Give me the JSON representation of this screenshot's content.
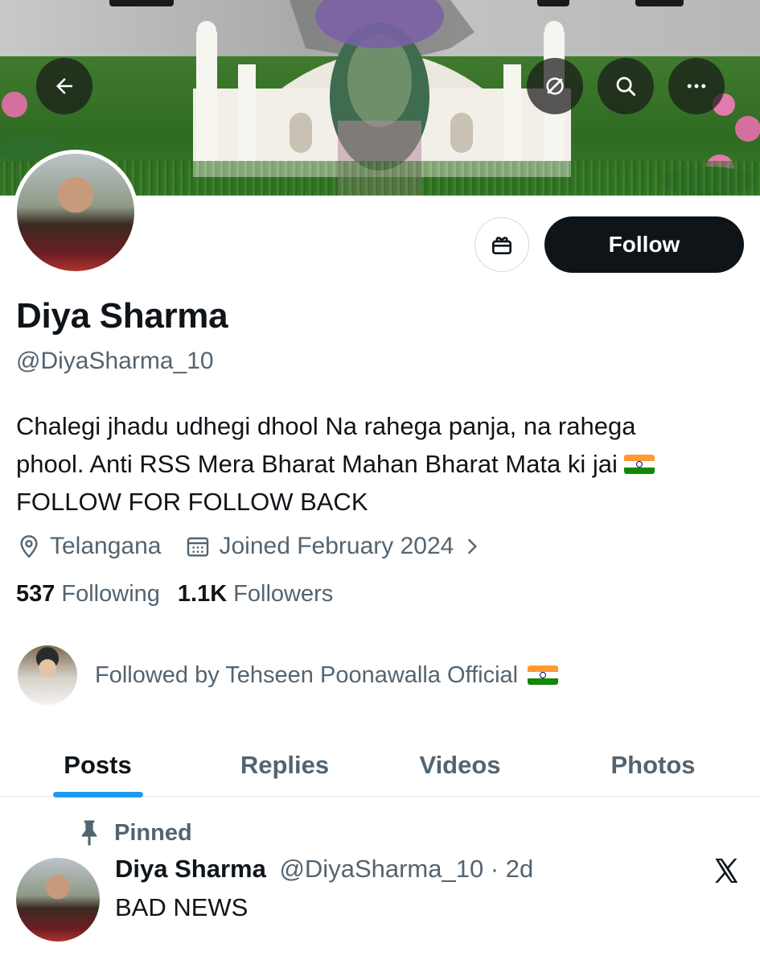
{
  "header": {
    "back_icon": "arrow-left-icon",
    "actions": [
      "grok-icon",
      "search-icon",
      "more-icon"
    ]
  },
  "profile": {
    "display_name": "Diya Sharma",
    "handle": "@DiyaSharma_10",
    "bio_line1": "Chalegi jhadu udhegi dhool Na rahega panja, na rahega",
    "bio_line2": "phool. Anti RSS Mera Bharat Mahan Bharat Mata ki jai",
    "bio_line3": "FOLLOW FOR FOLLOW BACK",
    "location": "Telangana",
    "joined": "Joined February 2024",
    "following_count": "537",
    "following_label": "Following",
    "followers_count": "1.1K",
    "followers_label": "Followers",
    "followed_by": "Followed by Tehseen Poonawalla Official"
  },
  "actions": {
    "follow_label": "Follow",
    "gift_icon": "gift-icon"
  },
  "tabs": [
    {
      "label": "Posts",
      "active": true
    },
    {
      "label": "Replies",
      "active": false
    },
    {
      "label": "Videos",
      "active": false
    },
    {
      "label": "Photos",
      "active": false
    }
  ],
  "post": {
    "pinned_label": "Pinned",
    "author": "Diya Sharma",
    "handle_time": "@DiyaSharma_10 · 2d",
    "text": "BAD NEWS"
  },
  "colors": {
    "accent": "#1d9bf0",
    "text_primary": "#0f1419",
    "text_secondary": "#536471"
  }
}
